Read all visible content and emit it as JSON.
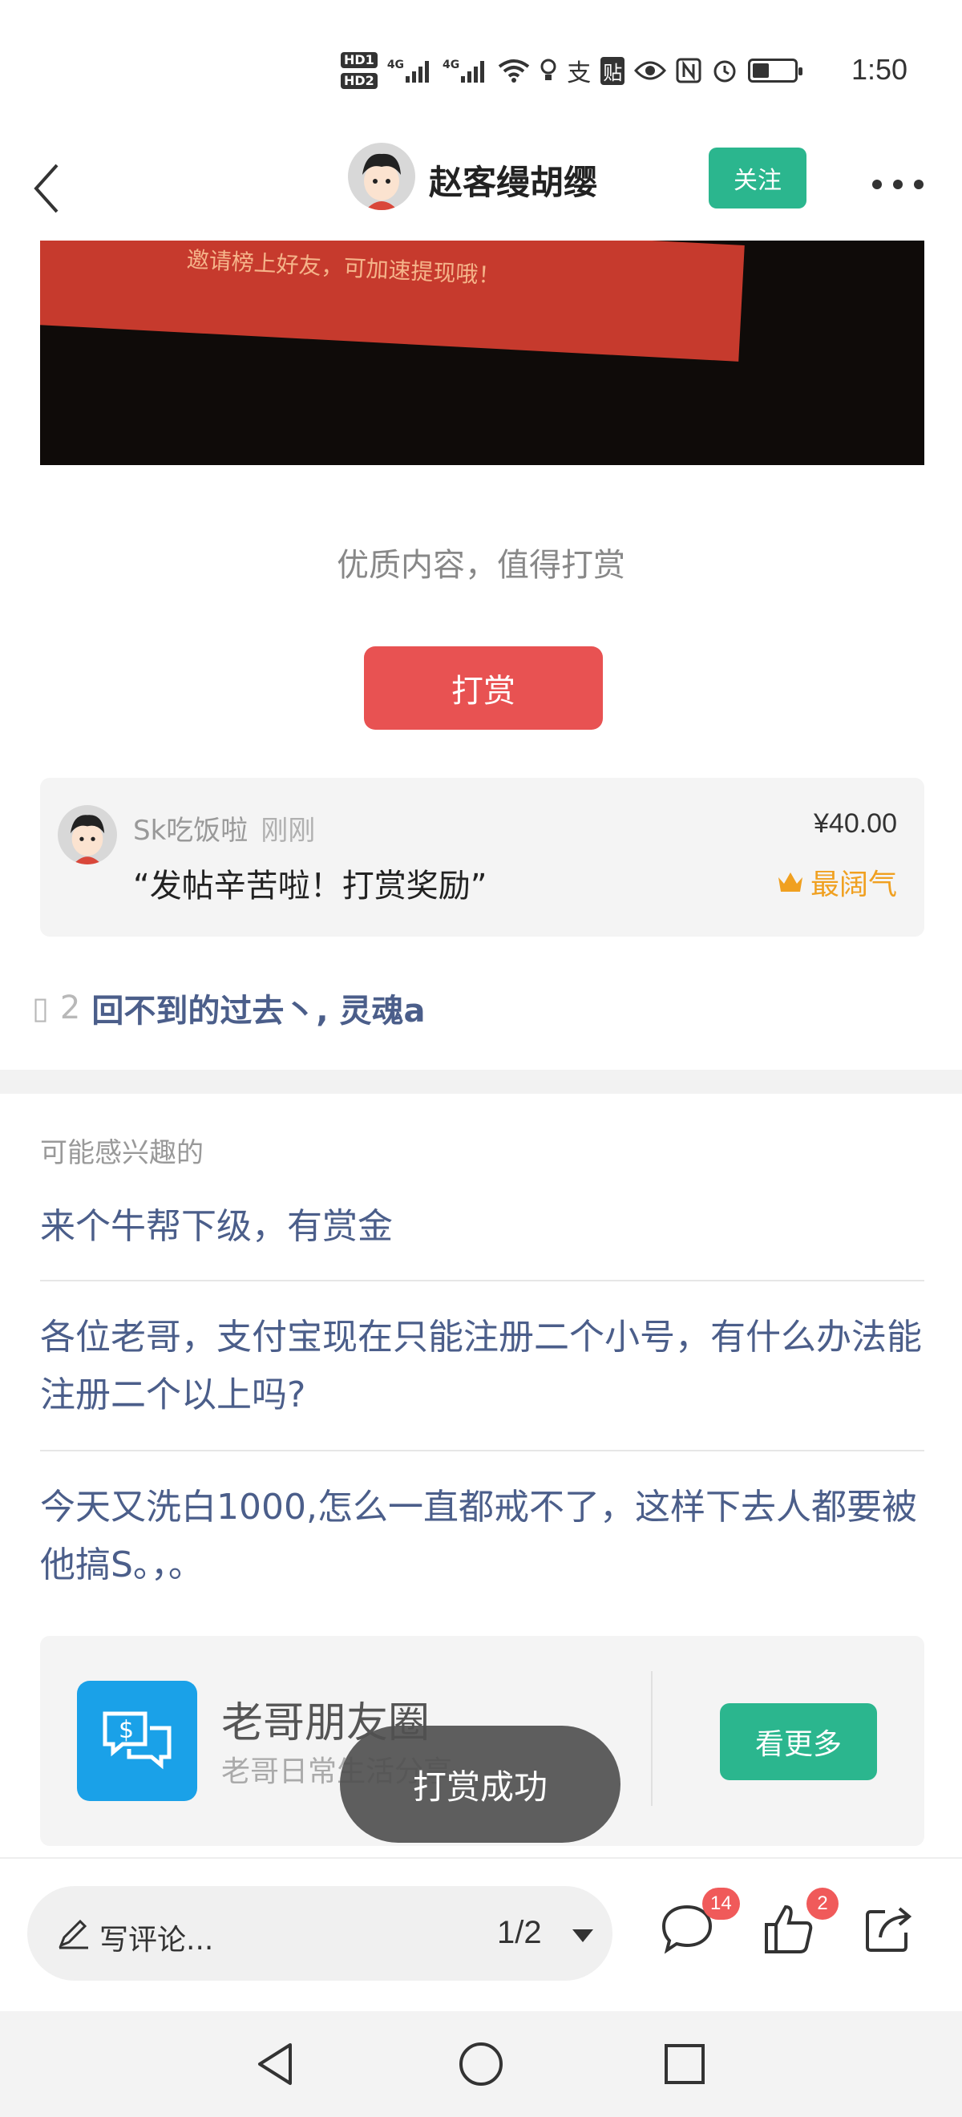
{
  "status_bar": {
    "hd_labels": [
      "HD1",
      "HD2"
    ],
    "network": [
      "4G",
      "4G"
    ],
    "time": "1:50",
    "battery_level": 0.4
  },
  "header": {
    "title": "赵客缦胡缨",
    "follow_label": "关注"
  },
  "post_image": {
    "overlay_text": "邀请榜上好友，可加速提现哦！"
  },
  "reward": {
    "prompt": "优质内容，值得打赏",
    "button_label": "打赏"
  },
  "reward_record": {
    "user": "Sk吃饭啦",
    "time": "刚刚",
    "amount": "¥40.00",
    "message": "“发帖辛苦啦！打赏奖励”",
    "badge": "最阔气"
  },
  "replies": {
    "count": "2",
    "users": "回不到的过去丶, 灵魂a"
  },
  "related": {
    "title": "可能感兴趣的",
    "items": [
      "来个牛帮下级，有赏金",
      "各位老哥，支付宝现在只能注册二个小号，有什么办法能注册二个以上吗?",
      "今天又洗白1000,怎么一直都戒不了，这样下去人都要被他搞S。，。"
    ]
  },
  "group": {
    "name": "老哥朋友圈",
    "desc": "老哥日常生活分享",
    "see_more_label": "看更多"
  },
  "toast": "打赏成功",
  "bottom_bar": {
    "comment_placeholder": "写评论...",
    "page": "1/2",
    "comment_badge": "14",
    "like_badge": "2"
  },
  "colors": {
    "accent_green": "#2bb68e",
    "reward_red": "#e85252",
    "link_blue": "#4b5e8a",
    "badge_orange": "#f0a020"
  }
}
